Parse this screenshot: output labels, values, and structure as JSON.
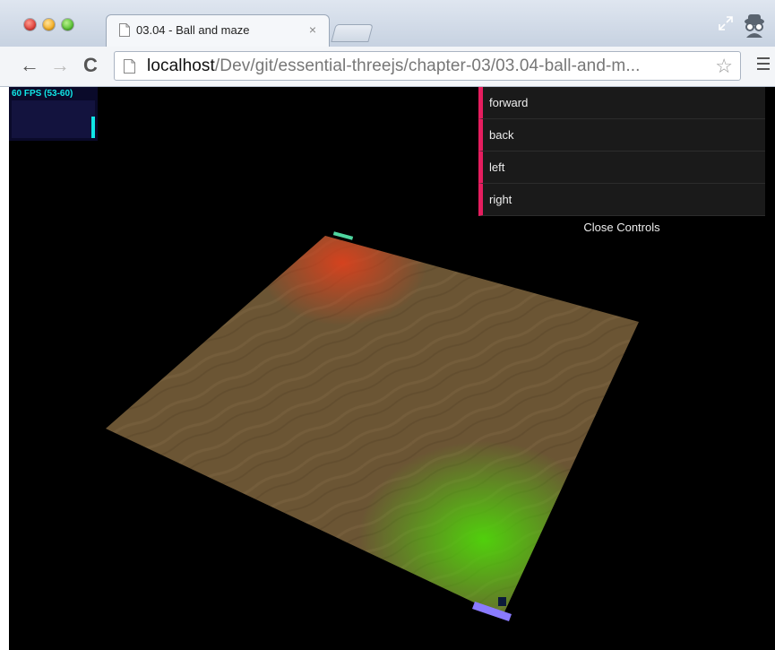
{
  "browser": {
    "tab_title": "03.04 - Ball and maze",
    "tab_close": "×",
    "url_host": "localhost",
    "url_path": "/Dev/git/essential-threejs/chapter-03/03.04-ball-and-m...",
    "star": "☆"
  },
  "nav": {
    "back": "←",
    "forward": "→",
    "reload": "C"
  },
  "stats": {
    "fps_text": "60 FPS (53-60)"
  },
  "gui": {
    "items": [
      {
        "label": "forward"
      },
      {
        "label": "back"
      },
      {
        "label": "left"
      },
      {
        "label": "right"
      }
    ],
    "close_label": "Close Controls"
  },
  "colors": {
    "gui_accent": "#e61d5f",
    "stats_text": "#10e6e6",
    "floor": "#6b5534"
  }
}
